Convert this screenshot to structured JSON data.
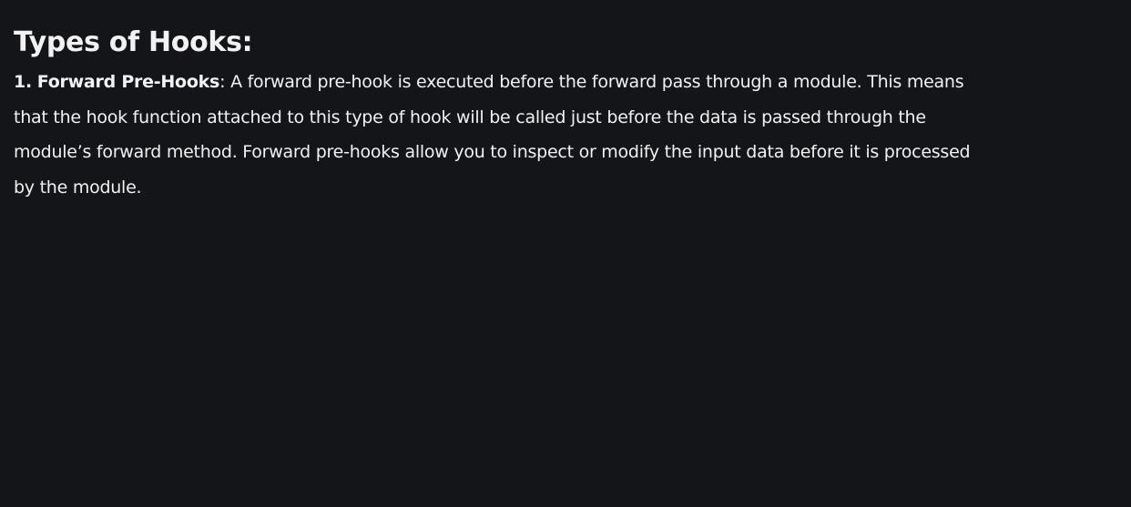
{
  "document": {
    "heading": "Types of Hooks:",
    "item": {
      "number": "1.",
      "term": "Forward Pre-Hooks",
      "separator": ":",
      "body": "A forward pre-hook is executed before the forward pass through a module. This means that the hook function attached to this type of hook will be called just before the data is passed through the module’s forward method. Forward pre-hooks allow you to inspect or modify the input data before it is processed by the module."
    }
  },
  "colors": {
    "background": "#141518",
    "text": "#f2f2f2"
  }
}
